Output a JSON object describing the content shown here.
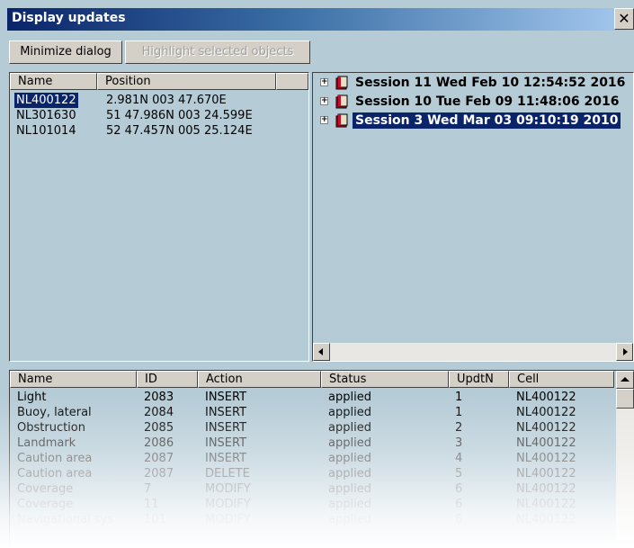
{
  "window": {
    "title": "Display updates"
  },
  "buttons": {
    "minimize": "Minimize dialog",
    "highlight": "Highlight selected objects"
  },
  "cells_list": {
    "columns": [
      "Name",
      "Position"
    ],
    "rows": [
      {
        "name": "NL400122",
        "position": "2.981N 003 47.670E"
      },
      {
        "name": "NL301630",
        "position": "51 47.986N 003 24.599E"
      },
      {
        "name": "NL101014",
        "position": "52 47.457N 005 25.124E"
      }
    ]
  },
  "sessions": [
    {
      "label": "Session 11 Wed Feb 10 12:54:52 2016"
    },
    {
      "label": "Session 10 Tue Feb 09 11:48:06 2016"
    },
    {
      "label": "Session 3 Wed Mar 03 09:10:19 2010"
    }
  ],
  "updates_table": {
    "columns": [
      "Name",
      "ID",
      "Action",
      "Status",
      "UpdtN",
      "Cell"
    ],
    "rows": [
      {
        "name": "Light",
        "id": "2083",
        "action": "INSERT",
        "status": "applied",
        "updtn": "1",
        "cell": "NL400122"
      },
      {
        "name": "Buoy, lateral",
        "id": "2084",
        "action": "INSERT",
        "status": "applied",
        "updtn": "1",
        "cell": "NL400122"
      },
      {
        "name": "Obstruction",
        "id": "2085",
        "action": "INSERT",
        "status": "applied",
        "updtn": "2",
        "cell": "NL400122"
      },
      {
        "name": "Landmark",
        "id": "2086",
        "action": "INSERT",
        "status": "applied",
        "updtn": "3",
        "cell": "NL400122"
      },
      {
        "name": "Caution area",
        "id": "2087",
        "action": "INSERT",
        "status": "applied",
        "updtn": "4",
        "cell": "NL400122"
      },
      {
        "name": "Caution area",
        "id": "2087",
        "action": "DELETE",
        "status": "applied",
        "updtn": "5",
        "cell": "NL400122"
      },
      {
        "name": "Coverage",
        "id": "7",
        "action": "MODIFY",
        "status": "applied",
        "updtn": "6",
        "cell": "NL400122"
      },
      {
        "name": "Coverage",
        "id": "11",
        "action": "MODIFY",
        "status": "applied",
        "updtn": "6",
        "cell": "NL400122"
      },
      {
        "name": "Navigational sys",
        "id": "101",
        "action": "MODIFY",
        "status": "applied",
        "updtn": "6",
        "cell": "NL400122"
      }
    ]
  },
  "icons": {
    "close": "close-icon",
    "book": "book-icon",
    "expand": "plus-icon"
  }
}
